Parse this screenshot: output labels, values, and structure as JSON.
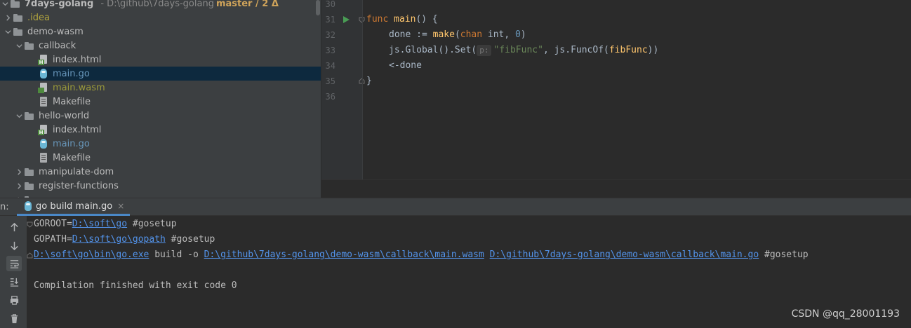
{
  "project": {
    "root_name": "7days-golang",
    "root_path": "- D:\\github\\7days-golang",
    "root_branch": "master / 2 Δ",
    "items": [
      {
        "label": ".idea",
        "style": "excluded"
      },
      {
        "label": "demo-wasm",
        "style": "normal"
      },
      {
        "label": "callback",
        "style": "normal"
      },
      {
        "label": "index.html",
        "style": "normal"
      },
      {
        "label": "main.go",
        "style": "go"
      },
      {
        "label": "main.wasm",
        "style": "ignored"
      },
      {
        "label": "Makefile",
        "style": "normal"
      },
      {
        "label": "hello-world",
        "style": "normal"
      },
      {
        "label": "index.html",
        "style": "normal"
      },
      {
        "label": "main.go",
        "style": "go"
      },
      {
        "label": "Makefile",
        "style": "normal"
      },
      {
        "label": "manipulate-dom",
        "style": "normal"
      },
      {
        "label": "register-functions",
        "style": "normal"
      }
    ]
  },
  "editor": {
    "line_numbers": [
      "30",
      "31",
      "32",
      "33",
      "34",
      "35",
      "36"
    ],
    "code": {
      "l31_kw": "func",
      "l31_fn": "main",
      "l31_rest": "() {",
      "l32_a": "done := ",
      "l32_fn": "make",
      "l32_b": "(",
      "l32_kw": "chan",
      "l32_c": " int, ",
      "l32_num": "0",
      "l32_d": ")",
      "l33_a": "js.Global().Set(",
      "l33_hint": "p:",
      "l33_str": "\"fibFunc\"",
      "l33_b": ", js.FuncOf(",
      "l33_fn": "fibFunc",
      "l33_c": "))",
      "l34": "<-done",
      "l35": "}"
    }
  },
  "run": {
    "label": "n:",
    "tab_label": "go build main.go",
    "tab_close": "×"
  },
  "console": {
    "l1_a": "GOROOT=",
    "l1_link": "D:\\soft\\go",
    "l1_b": " #gosetup",
    "l2_a": "GOPATH=",
    "l2_link": "D:\\soft\\go\\gopath",
    "l2_b": " #gosetup",
    "l3_link1": "D:\\soft\\go\\bin\\go.exe",
    "l3_a": " build -o ",
    "l3_link2": "D:\\github\\7days-golang\\demo-wasm\\callback\\main.wasm",
    "l3_b": " ",
    "l3_link3": "D:\\github\\7days-golang\\demo-wasm\\callback\\main.go",
    "l3_c": " #gosetup",
    "l5": "Compilation finished with exit code 0"
  },
  "watermark": "CSDN @qq_28001193",
  "colors": {
    "accent": "#4a88c7",
    "link": "#5394ec",
    "selection": "#0d293e"
  }
}
